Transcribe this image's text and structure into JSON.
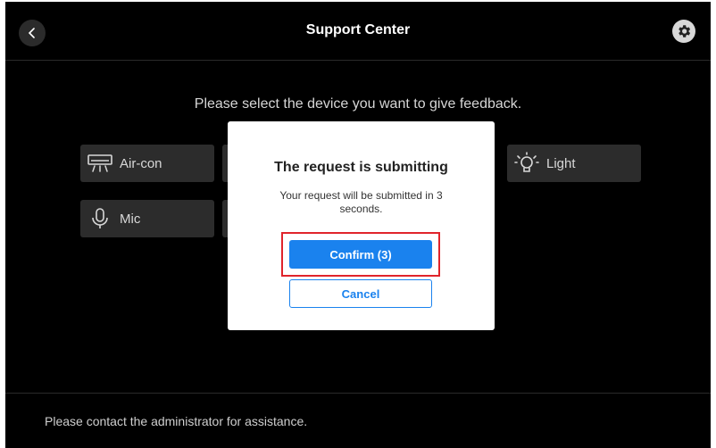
{
  "header": {
    "title": "Support Center",
    "back_icon": "chevron-left-icon",
    "settings_icon": "gear-icon"
  },
  "main": {
    "prompt": "Please select the device you want to give feedback.",
    "devices": [
      {
        "label": "Air-con",
        "icon": "air-conditioner-icon"
      },
      {
        "label": "Mic",
        "icon": "microphone-icon"
      },
      {
        "label": "Light",
        "icon": "light-bulb-icon"
      }
    ]
  },
  "dialog": {
    "title": "The request is submitting",
    "message": "Your request will be submitted in 3 seconds.",
    "confirm_label": "Confirm (3)",
    "cancel_label": "Cancel"
  },
  "footer": {
    "text": "Please contact the administrator for assistance."
  },
  "colors": {
    "background": "#000000",
    "accent": "#1a82ee",
    "highlight": "#e0242b"
  }
}
